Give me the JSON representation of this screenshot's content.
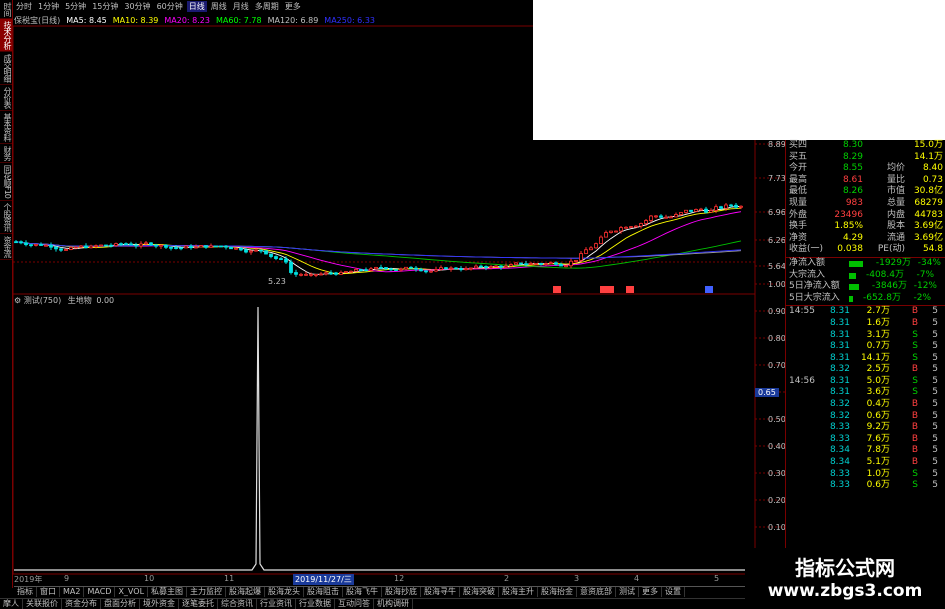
{
  "left_tabs": [
    "时间",
    "技术分析",
    "成交明细",
    "分价表",
    "基本资料",
    "财务",
    "同花顺F10",
    "个股资讯",
    "资金流"
  ],
  "period_bar": [
    "分时",
    "1分钟",
    "5分钟",
    "15分钟",
    "30分钟",
    "60分钟",
    "日线",
    "周线",
    "月线",
    "多周期",
    "更多"
  ],
  "period_active_index": 6,
  "ma_bar": {
    "stock_label": "保税宝(日线)",
    "items": [
      {
        "label": "MA5: 8.45",
        "color": "#ffffff"
      },
      {
        "label": "MA10: 8.39",
        "color": "#ffff00"
      },
      {
        "label": "MA20: 8.23",
        "color": "#ff00ff"
      },
      {
        "label": "MA60: 7.78",
        "color": "#00ff00"
      },
      {
        "label": "MA120: 6.89",
        "color": "#c0c0c0"
      },
      {
        "label": "MA250: 6.33",
        "color": "#3030ff"
      }
    ]
  },
  "price_axis": [
    "8.89",
    "7.73",
    "6.96",
    "6.26",
    "5.64"
  ],
  "low_marker": "5.23",
  "indicator": {
    "name": "测试(750)",
    "label": "生地物",
    "value": "0.00"
  },
  "indicator_axis": [
    "1.00",
    "0.90",
    "0.80",
    "0.70",
    "0.65",
    "0.50",
    "0.40",
    "0.30",
    "0.20",
    "0.10",
    "0.00"
  ],
  "indicator_current": "0.65",
  "date_bar": {
    "items": [
      "2019年",
      "9",
      "10",
      "11",
      "12",
      "2",
      "3",
      "4",
      "5"
    ],
    "highlight": "2019/11/27/三"
  },
  "quote": [
    {
      "k1": "买四",
      "v1": "8.30",
      "k2": "",
      "v2": "15.0万"
    },
    {
      "k1": "买五",
      "v1": "8.29",
      "k2": "",
      "v2": "14.1万"
    },
    {
      "k1": "今开",
      "v1": "8.55",
      "k2": "均价",
      "v2": "8.40"
    },
    {
      "k1": "最高",
      "v1": "8.61",
      "k2": "量比",
      "v2": "0.73"
    },
    {
      "k1": "最低",
      "v1": "8.26",
      "k2": "市值",
      "v2": "30.8亿"
    },
    {
      "k1": "现量",
      "v1": "983",
      "k2": "总量",
      "v2": "68279"
    },
    {
      "k1": "外盘",
      "v1": "23496",
      "k2": "内盘",
      "v2": "44783"
    },
    {
      "k1": "换手",
      "v1": "1.85%",
      "k2": "股本",
      "v2": "3.69亿"
    },
    {
      "k1": "净资",
      "v1": "4.29",
      "k2": "流通",
      "v2": "3.69亿"
    },
    {
      "k1": "收益(一)",
      "v1": "0.038",
      "k2": "PE(动)",
      "v2": "54.8"
    }
  ],
  "flows": [
    {
      "label": "净流入额",
      "value": "-1929万",
      "pct": "-34%",
      "bar": 14
    },
    {
      "label": "大宗流入",
      "value": "-408.4万",
      "pct": "-7%",
      "bar": 7
    },
    {
      "label": "5日净流入额",
      "value": "-3846万",
      "pct": "-12%",
      "bar": 10
    },
    {
      "label": "5日大宗流入",
      "value": "-652.8万",
      "pct": "-2%",
      "bar": 4
    }
  ],
  "ticks": [
    {
      "time": "14:55",
      "price": "8.31",
      "vol": "2.7万",
      "dir": "B",
      "n": "5"
    },
    {
      "time": "",
      "price": "8.31",
      "vol": "1.6万",
      "dir": "B",
      "n": "5"
    },
    {
      "time": "",
      "price": "8.31",
      "vol": "3.1万",
      "dir": "S",
      "n": "5"
    },
    {
      "time": "",
      "price": "8.31",
      "vol": "0.7万",
      "dir": "S",
      "n": "5"
    },
    {
      "time": "",
      "price": "8.31",
      "vol": "14.1万",
      "dir": "S",
      "n": "5"
    },
    {
      "time": "",
      "price": "8.32",
      "vol": "2.5万",
      "dir": "B",
      "n": "5"
    },
    {
      "time": "14:56",
      "price": "8.31",
      "vol": "5.0万",
      "dir": "S",
      "n": "5"
    },
    {
      "time": "",
      "price": "8.31",
      "vol": "3.6万",
      "dir": "S",
      "n": "5"
    },
    {
      "time": "",
      "price": "8.32",
      "vol": "0.4万",
      "dir": "B",
      "n": "5"
    },
    {
      "time": "",
      "price": "8.32",
      "vol": "0.6万",
      "dir": "B",
      "n": "5"
    },
    {
      "time": "",
      "price": "8.33",
      "vol": "9.2万",
      "dir": "B",
      "n": "5"
    },
    {
      "time": "",
      "price": "8.33",
      "vol": "7.6万",
      "dir": "B",
      "n": "5"
    },
    {
      "time": "",
      "price": "8.34",
      "vol": "7.8万",
      "dir": "B",
      "n": "5"
    },
    {
      "time": "",
      "price": "8.34",
      "vol": "5.1万",
      "dir": "B",
      "n": "5"
    },
    {
      "time": "",
      "price": "8.33",
      "vol": "1.0万",
      "dir": "S",
      "n": "5"
    },
    {
      "time": "",
      "price": "8.33",
      "vol": "0.6万",
      "dir": "S",
      "n": "5"
    }
  ],
  "bottom_bar1": [
    "指标",
    "窗口",
    "MA2",
    "MACD",
    "X_VOL",
    "私募主图",
    "主力监控",
    "股海起爆",
    "股海龙头",
    "股海阻击",
    "股海飞牛",
    "股海抄底",
    "股海寻牛",
    "股海突破",
    "股海主升",
    "股海抬金",
    "意资底部",
    "测试",
    "更多",
    "设置"
  ],
  "bottom_bar2": [
    "摩人",
    "关联报价",
    "资金分布",
    "盘面分析",
    "境外资金",
    "逐笔委托",
    "综合资讯",
    "行业资讯",
    "行业数据",
    "互动问答",
    "机构调研"
  ],
  "watermark": {
    "title": "指标公式网",
    "url": "www.zbgs3.com"
  }
}
